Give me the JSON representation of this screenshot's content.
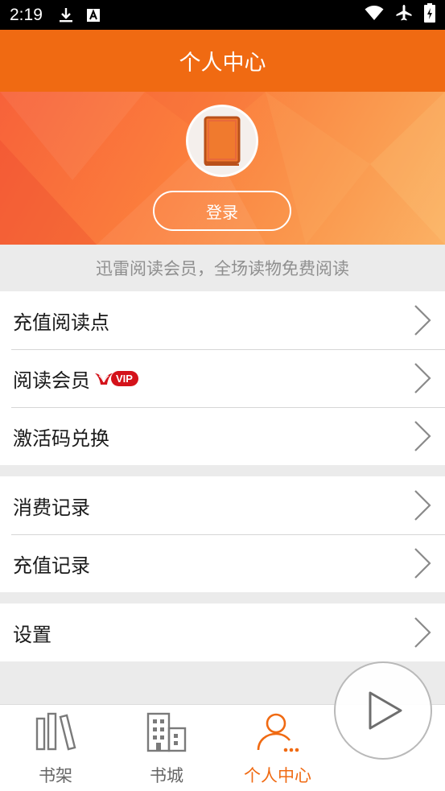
{
  "status_bar": {
    "time": "2:19",
    "left_icons": [
      "download-icon",
      "a-icon"
    ],
    "right_icons": [
      "wifi-icon",
      "airplane-icon",
      "battery-icon"
    ]
  },
  "header": {
    "title": "个人中心"
  },
  "profile": {
    "avatar_icon": "book-icon",
    "login_label": "登录"
  },
  "member_tip": "迅雷阅读会员，全场读物免费阅读",
  "menu_groups": [
    {
      "items": [
        {
          "label": "充值阅读点"
        },
        {
          "label": "阅读会员",
          "badge": "VIP"
        },
        {
          "label": "激活码兑换"
        }
      ]
    },
    {
      "items": [
        {
          "label": "消费记录"
        },
        {
          "label": "充值记录"
        }
      ]
    },
    {
      "items": [
        {
          "label": "设置"
        }
      ]
    }
  ],
  "tabs": [
    {
      "label": "书架",
      "icon": "bookshelf-icon",
      "active": false
    },
    {
      "label": "书城",
      "icon": "bookstore-icon",
      "active": false
    },
    {
      "label": "个人中心",
      "icon": "person-icon",
      "active": true
    }
  ],
  "floating_button": {
    "icon": "play-icon"
  },
  "colors": {
    "accent": "#f06a12",
    "vip_red": "#d4121a"
  }
}
